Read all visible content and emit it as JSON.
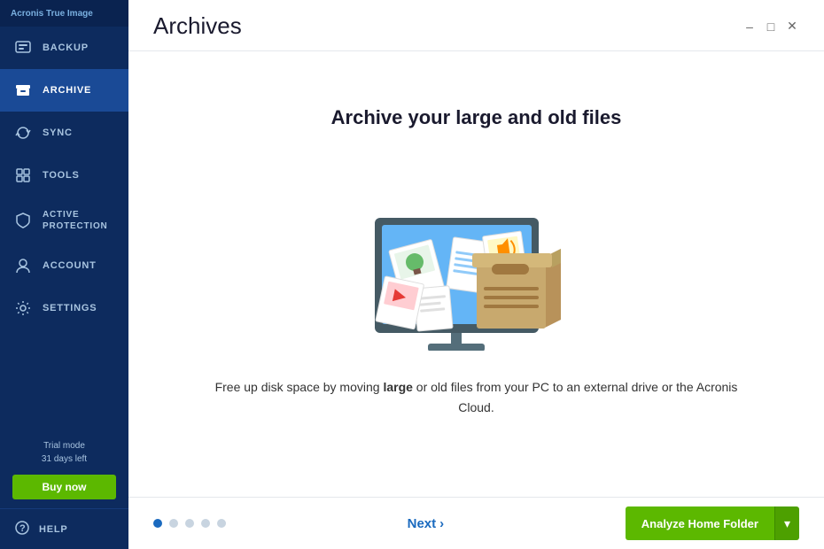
{
  "app": {
    "title": "Acronis True Image",
    "logo_text": "Acronis True Image"
  },
  "sidebar": {
    "items": [
      {
        "id": "backup",
        "label": "BACKUP",
        "icon": "backup-icon",
        "active": false
      },
      {
        "id": "archive",
        "label": "ARCHIVE",
        "icon": "archive-icon",
        "active": true
      },
      {
        "id": "sync",
        "label": "SYNC",
        "icon": "sync-icon",
        "active": false
      },
      {
        "id": "tools",
        "label": "TOOLS",
        "icon": "tools-icon",
        "active": false
      },
      {
        "id": "active-protection",
        "label": "ACTIVE PROTECTION",
        "icon": "shield-icon",
        "active": false
      },
      {
        "id": "account",
        "label": "ACCOUNT",
        "icon": "account-icon",
        "active": false
      },
      {
        "id": "settings",
        "label": "SETTINGS",
        "icon": "settings-icon",
        "active": false
      }
    ],
    "trial_mode": "Trial mode",
    "days_left": "31 days left",
    "buy_now": "Buy now",
    "help_label": "HELP"
  },
  "main": {
    "title": "Archives",
    "headline": "Archive your large and old files",
    "description": "Free up disk space by moving large or old files from your PC to an external drive or the Acronis Cloud.",
    "description_bold_words": [
      "large"
    ],
    "pagination": {
      "total": 5,
      "active": 0
    },
    "next_button": "Next",
    "analyze_button": "Analyze Home Folder",
    "dropdown_arrow": "▾"
  },
  "window_controls": {
    "minimize": "–",
    "maximize": "□",
    "close": "✕"
  }
}
